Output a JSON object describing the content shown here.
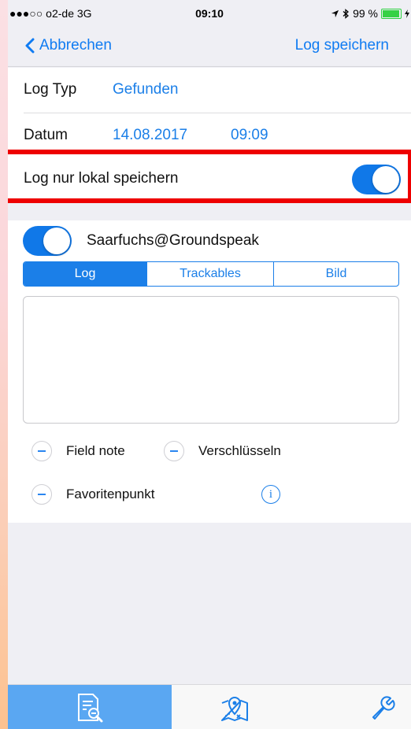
{
  "status_bar": {
    "carrier": "●●●○○ o2-de  3G",
    "time": "09:10",
    "battery": "99 %",
    "battery_level": 0.99
  },
  "nav": {
    "back_label": "Abbrechen",
    "save_label": "Log speichern"
  },
  "form": {
    "log_typ_label": "Log Typ",
    "log_typ_value": "Gefunden",
    "datum_label": "Datum",
    "datum_date": "14.08.2017",
    "datum_time": "09:09",
    "local_label": "Log nur lokal speichern",
    "local_toggle_on": true
  },
  "account": {
    "name": "Saarfuchs@Groundspeak",
    "toggle_on": true
  },
  "tabs": [
    {
      "label": "Log",
      "selected": true
    },
    {
      "label": "Trackables",
      "selected": false
    },
    {
      "label": "Bild",
      "selected": false
    }
  ],
  "options": {
    "field_note": "Field note",
    "encrypt": "Verschlüsseln",
    "favorite": "Favoritenpunkt",
    "info_glyph": "i"
  },
  "tabbar": {
    "items": [
      "search-list-icon",
      "map-pin-icon",
      "wrench-icon"
    ],
    "active_index": 0
  },
  "colors": {
    "accent": "#1b7fe8",
    "highlight": "#ee0000",
    "tab_active": "#5aa7f2"
  }
}
